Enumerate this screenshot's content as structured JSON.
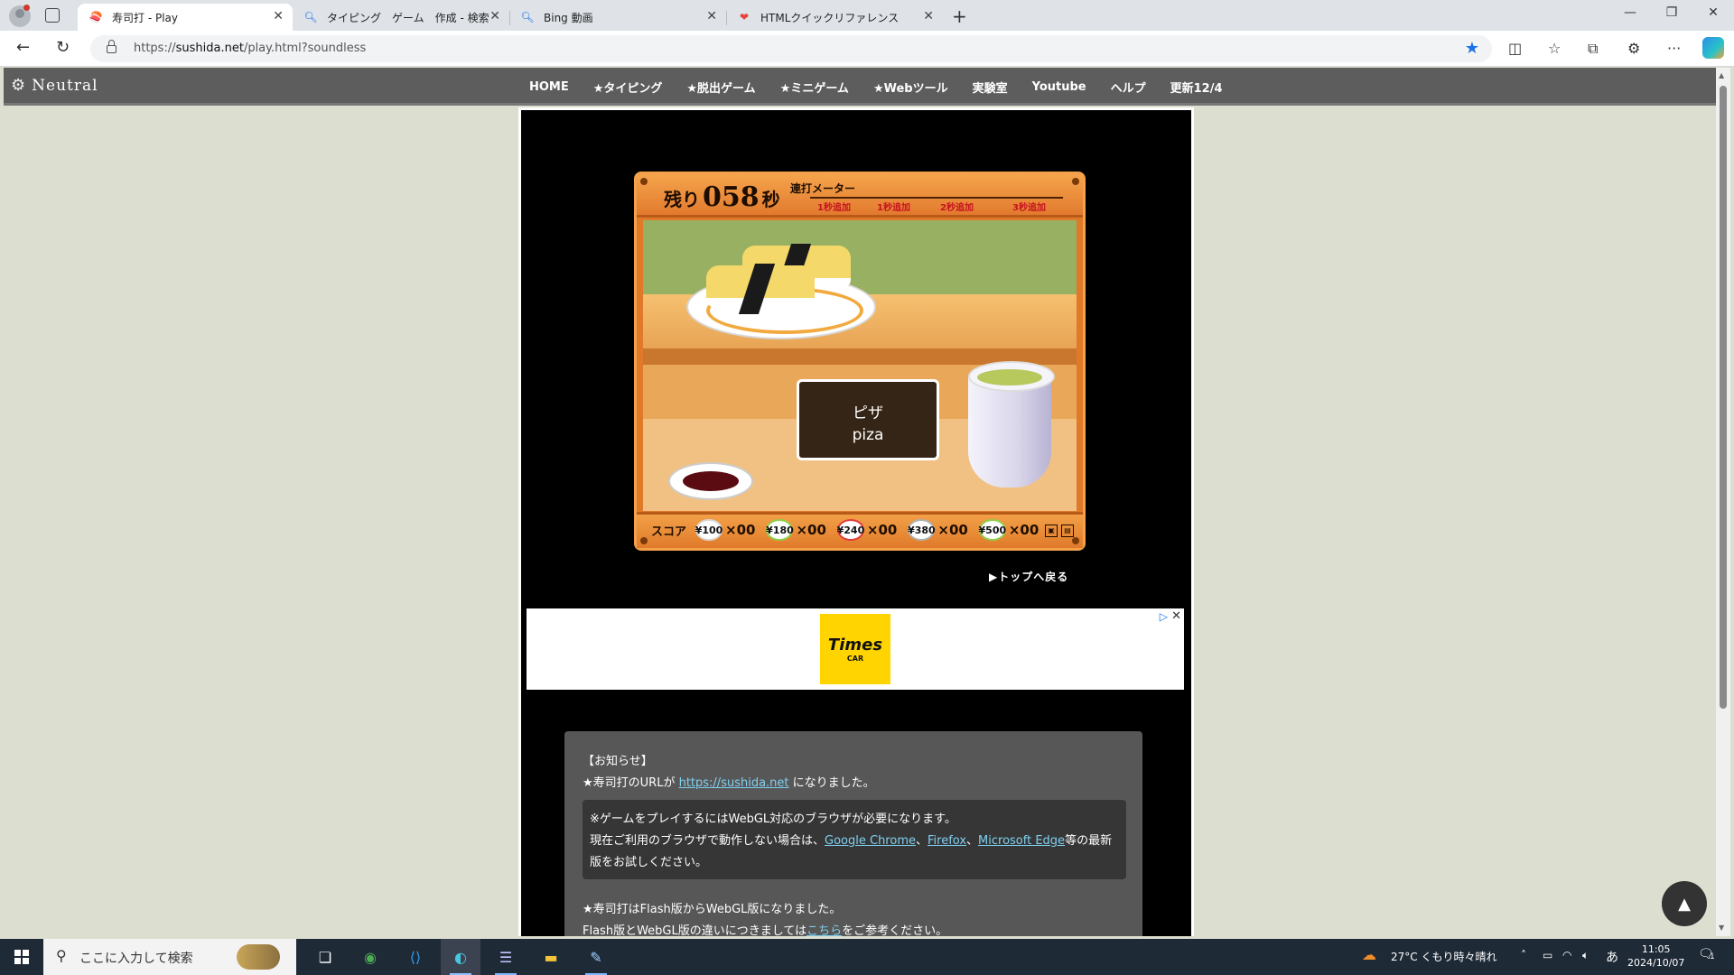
{
  "browser": {
    "tabs": [
      {
        "title": "寿司打 - Play",
        "icon": "sushi-favicon"
      },
      {
        "title": "タイピング　ゲーム　作成 - 検索",
        "icon": "search-icon"
      },
      {
        "title": "Bing 動画",
        "icon": "search-icon"
      },
      {
        "title": "HTMLクイックリファレンス",
        "icon": "heart-favicon"
      }
    ],
    "url_prefix": "https://",
    "url_host": "sushida.net",
    "url_path": "/play.html?soundless"
  },
  "site": {
    "logo": "Neutral",
    "menu": [
      "HOME",
      "★タイピング",
      "★脱出ゲーム",
      "★ミニゲーム",
      "★Webツール",
      "実験室",
      "Youtube",
      "ヘルプ",
      "更新12/4"
    ]
  },
  "game": {
    "timer_prefix": "残り",
    "timer_value": "058",
    "timer_suffix": "秒",
    "meter_title": "連打メーター",
    "meter_marks": [
      "1秒追加",
      "1秒追加",
      "2秒追加",
      "3秒追加"
    ],
    "word_jp": "ピザ",
    "word_romaji": "piza",
    "score_label": "スコア",
    "plates": [
      {
        "price": "¥100",
        "count": "×00",
        "color": "#d8d8d8"
      },
      {
        "price": "¥180",
        "count": "×00",
        "color": "#8fcf4a"
      },
      {
        "price": "¥240",
        "count": "×00",
        "color": "#e23a3a"
      },
      {
        "price": "¥380",
        "count": "×00",
        "color": "#b0b0b0"
      },
      {
        "price": "¥500",
        "count": "×00",
        "color": "#8fcf4a"
      }
    ],
    "back_link": "▶トップへ戻る"
  },
  "ad": {
    "brand": "Times",
    "brand_sub": "CAR"
  },
  "notice": {
    "heading": "【お知らせ】",
    "line1_pre": "★寿司打のURLが",
    "line1_link": "https://sushida.net",
    "line1_post": "になりました。",
    "box_line1": "※ゲームをプレイするにはWebGL対応のブラウザが必要になります。",
    "box_line2_pre": "現在ご利用のブラウザで動作しない場合は、",
    "box_link1": "Google Chrome",
    "box_sep1": "、",
    "box_link2": "Firefox",
    "box_sep2": "、",
    "box_link3": "Microsoft Edge",
    "box_line2_post": "等の最新",
    "box_line3": "版をお試しください。",
    "line3": "★寿司打はFlash版からWebGL版になりました。",
    "line4_pre": "Flash版とWebGL版の違いにつきましては",
    "line4_link": "こちら",
    "line4_post": "をご参考ください。"
  },
  "taskbar": {
    "search_placeholder": "ここに入力して検索",
    "weather": "27°C くもり時々晴れ",
    "ime": "あ",
    "time": "11:05",
    "date": "2024/10/07",
    "notification_count": "1"
  }
}
